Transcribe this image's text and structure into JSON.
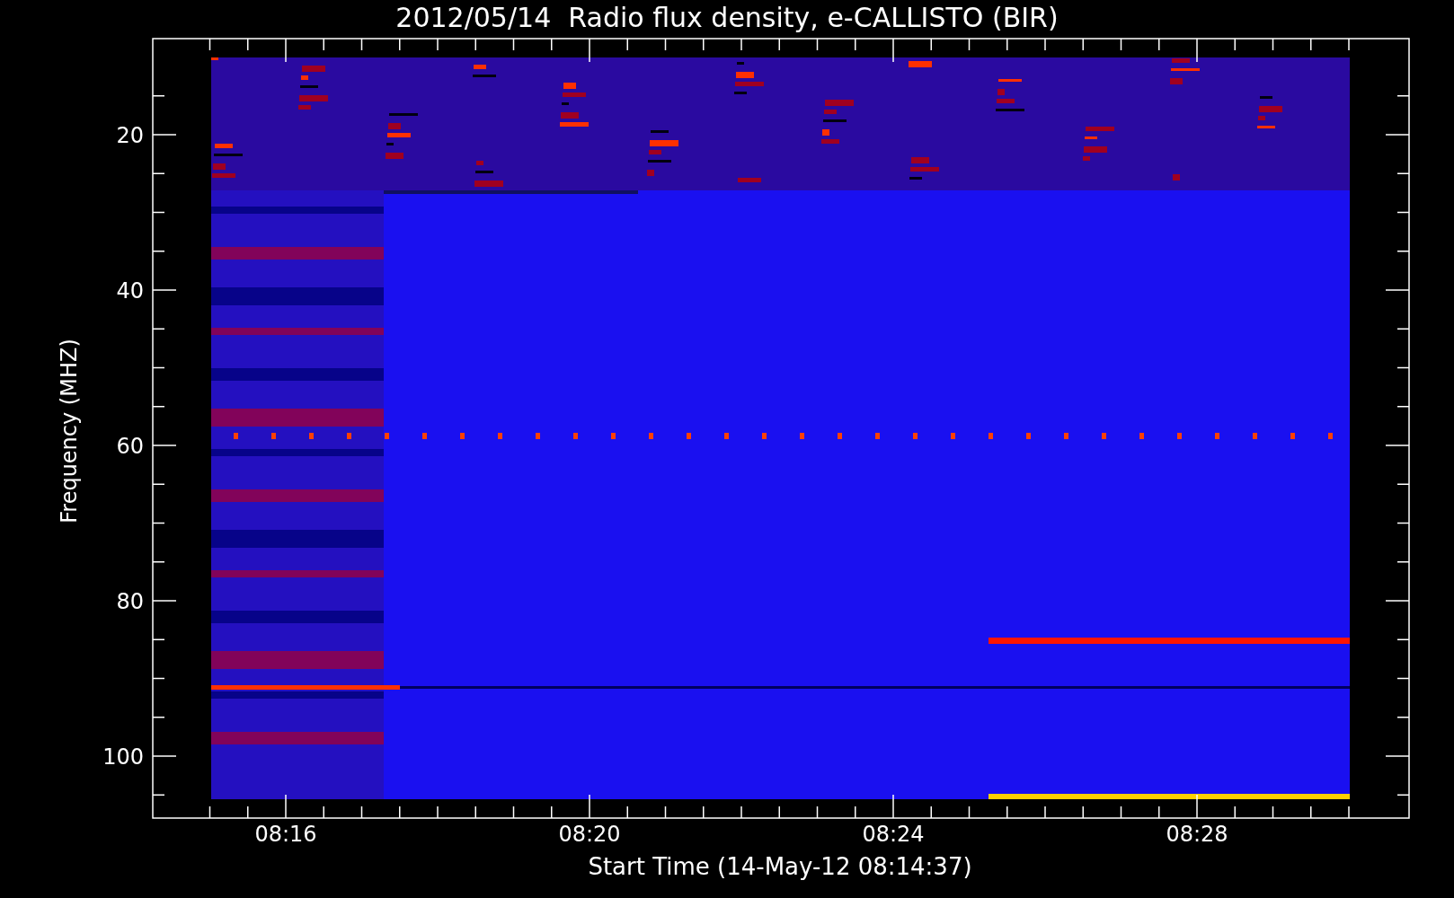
{
  "plot": {
    "title": "2012/05/14  Radio flux density, e-CALLISTO (BIR)",
    "xlabel": "Start Time (14-May-12 08:14:37)",
    "ylabel": "Frequency (MHZ)",
    "y_tick_labels": [
      "20",
      "40",
      "60",
      "80",
      "100"
    ],
    "x_tick_labels": [
      "08:16",
      "08:20",
      "08:24",
      "08:28"
    ]
  }
}
